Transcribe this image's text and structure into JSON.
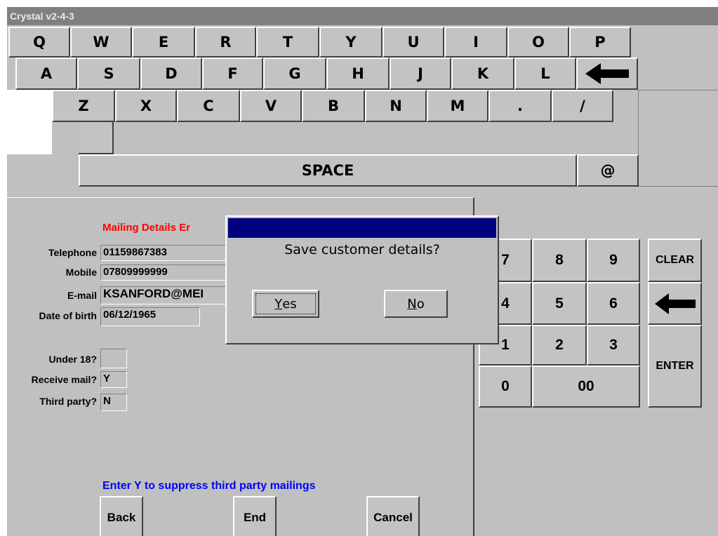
{
  "window": {
    "title": "Crystal v2-4-3"
  },
  "keyboard": {
    "row1": [
      "Q",
      "W",
      "E",
      "R",
      "T",
      "Y",
      "U",
      "I",
      "O",
      "P"
    ],
    "row2": [
      "A",
      "S",
      "D",
      "F",
      "G",
      "H",
      "J",
      "K",
      "L"
    ],
    "row3": [
      "Z",
      "X",
      "C",
      "V",
      "B",
      "N",
      "M",
      ".",
      "/"
    ],
    "space": "SPACE",
    "at": "@"
  },
  "form": {
    "heading": "Mailing Details Er",
    "telephone": {
      "label": "Telephone",
      "value": "01159867383"
    },
    "mobile": {
      "label": "Mobile",
      "value": "07809999999"
    },
    "email": {
      "label": "E-mail",
      "value": "KSANFORD@MEI"
    },
    "dob": {
      "label": "Date of birth",
      "value": "06/12/1965"
    },
    "under18": {
      "label": "Under 18?",
      "value": ""
    },
    "receive_mail": {
      "label": "Receive mail?",
      "value": "Y"
    },
    "third_party": {
      "label": "Third party?",
      "value": "N"
    },
    "hint": "Enter Y to suppress third party mailings"
  },
  "buttons": {
    "back": "Back",
    "end": "End",
    "cancel": "Cancel"
  },
  "numpad": {
    "keys": [
      "7",
      "8",
      "9",
      "4",
      "5",
      "6",
      "1",
      "2",
      "3",
      "0",
      "00"
    ],
    "clear": "CLEAR",
    "enter": "ENTER"
  },
  "dialog": {
    "message": "Save customer details?",
    "yes_mnemonic": "Y",
    "yes_rest": "es",
    "no_mnemonic": "N",
    "no_rest": "o"
  },
  "colors": {
    "heading": "#ff0000",
    "hint": "#0000ff",
    "dialog_title": "#000080"
  },
  "icons": {
    "backspace": "left-arrow-icon"
  }
}
